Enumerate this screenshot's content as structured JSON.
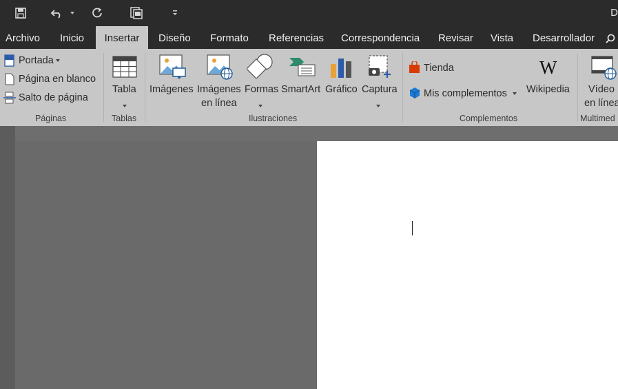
{
  "title_bar": {
    "title": "D"
  },
  "tabs": [
    "Archivo",
    "Inicio",
    "Insertar",
    "Diseño",
    "Formato",
    "Referencias",
    "Correspondencia",
    "Revisar",
    "Vista",
    "Desarrollador"
  ],
  "groups": {
    "paginas": {
      "label": "Páginas",
      "portada": "Portada",
      "pagina_blanco": "Página en blanco",
      "salto": "Salto de página"
    },
    "tablas": {
      "label": "Tablas",
      "tabla": "Tabla"
    },
    "ilustraciones": {
      "label": "Ilustraciones",
      "imagenes": "Imágenes",
      "imagenes_linea_1": "Imágenes",
      "imagenes_linea_2": "en línea",
      "formas": "Formas",
      "smartart": "SmartArt",
      "grafico": "Gráfico",
      "captura": "Captura"
    },
    "complementos": {
      "label": "Complementos",
      "tienda": "Tienda",
      "mis_complementos": "Mis complementos",
      "wikipedia": "Wikipedia"
    },
    "multimedia": {
      "label": "Multimed",
      "video_1": "Vídeo",
      "video_2": "en línea"
    }
  }
}
